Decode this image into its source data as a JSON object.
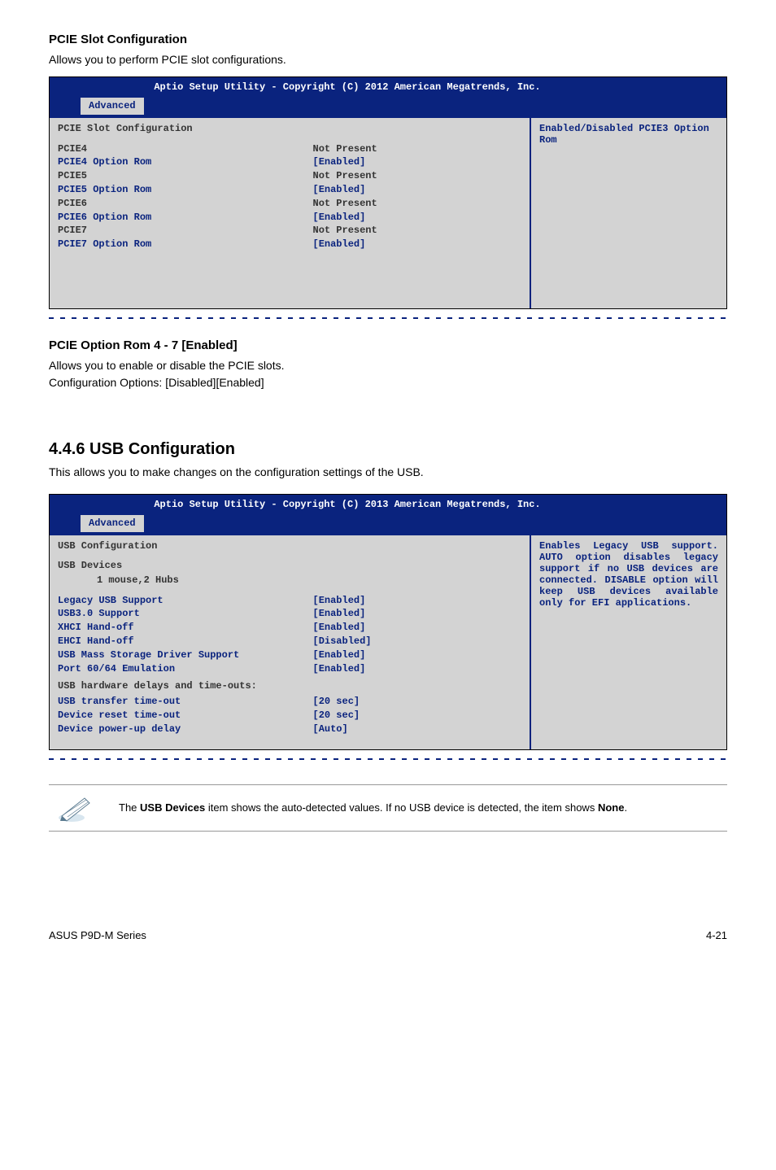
{
  "section1": {
    "heading": "PCIE Slot Configuration",
    "desc": "Allows you to perform PCIE slot configurations."
  },
  "bios1": {
    "header": "Aptio Setup Utility - Copyright (C) 2012 American Megatrends, Inc.",
    "tab": "Advanced",
    "title": "PCIE Slot Configuration",
    "rows": [
      {
        "label": "PCIE4",
        "value": "Not Present",
        "dark": true
      },
      {
        "label": "PCIE4 Option Rom",
        "value": "[Enabled]",
        "dark": false
      },
      {
        "label": "PCIE5",
        "value": "Not Present",
        "dark": true
      },
      {
        "label": "PCIE5 Option Rom",
        "value": "[Enabled]",
        "dark": false
      },
      {
        "label": "PCIE6",
        "value": "Not Present",
        "dark": true
      },
      {
        "label": "PCIE6 Option Rom",
        "value": "[Enabled]",
        "dark": false
      },
      {
        "label": "PCIE7",
        "value": "Not Present",
        "dark": true
      },
      {
        "label": "PCIE7 Option Rom",
        "value": "[Enabled]",
        "dark": false
      }
    ],
    "help": "Enabled/Disabled PCIE3 Option Rom"
  },
  "section2": {
    "heading": "PCIE Option Rom 4 - 7 [Enabled]",
    "desc1": "Allows you to enable or disable the PCIE slots.",
    "desc2": "Configuration Options: [Disabled][Enabled]"
  },
  "section3": {
    "heading": "4.4.6 USB Configuration",
    "desc": "This allows you to make changes on the configuration settings of the USB."
  },
  "bios2": {
    "header": "Aptio Setup Utility - Copyright (C) 2013 American Megatrends, Inc.",
    "tab": "Advanced",
    "title": "USB Configuration",
    "subtitle": "USB Devices",
    "subline": "1 mouse,2 Hubs",
    "rows": [
      {
        "label": "Legacy USB Support",
        "value": "[Enabled]",
        "dark": false
      },
      {
        "label": "USB3.0 Support",
        "value": "[Enabled]",
        "dark": false
      },
      {
        "label": "XHCI Hand-off",
        "value": "[Enabled]",
        "dark": false
      },
      {
        "label": "EHCI Hand-off",
        "value": "[Disabled]",
        "dark": false
      },
      {
        "label": "USB Mass Storage Driver Support",
        "value": "[Enabled]",
        "dark": false
      },
      {
        "label": "Port 60/64 Emulation",
        "value": "[Enabled]",
        "dark": false
      }
    ],
    "grouptitle": "USB hardware delays and time-outs:",
    "rows2": [
      {
        "label": "USB transfer time-out",
        "value": "[20 sec]",
        "dark": false
      },
      {
        "label": "Device reset time-out",
        "value": "[20 sec]",
        "dark": false
      },
      {
        "label": "Device power-up delay",
        "value": "[Auto]",
        "dark": false
      }
    ],
    "help": "Enables Legacy USB support. AUTO option disables legacy support if no USB devices are connected. DISABLE option will keep USB devices available only for EFI applications."
  },
  "note": {
    "prefix": "The ",
    "bold1": "USB Devices",
    "mid": " item shows the auto-detected values. If no USB device is detected, the item shows ",
    "bold2": "None",
    "suffix": "."
  },
  "footer": {
    "left": "ASUS P9D-M Series",
    "right": "4-21"
  }
}
